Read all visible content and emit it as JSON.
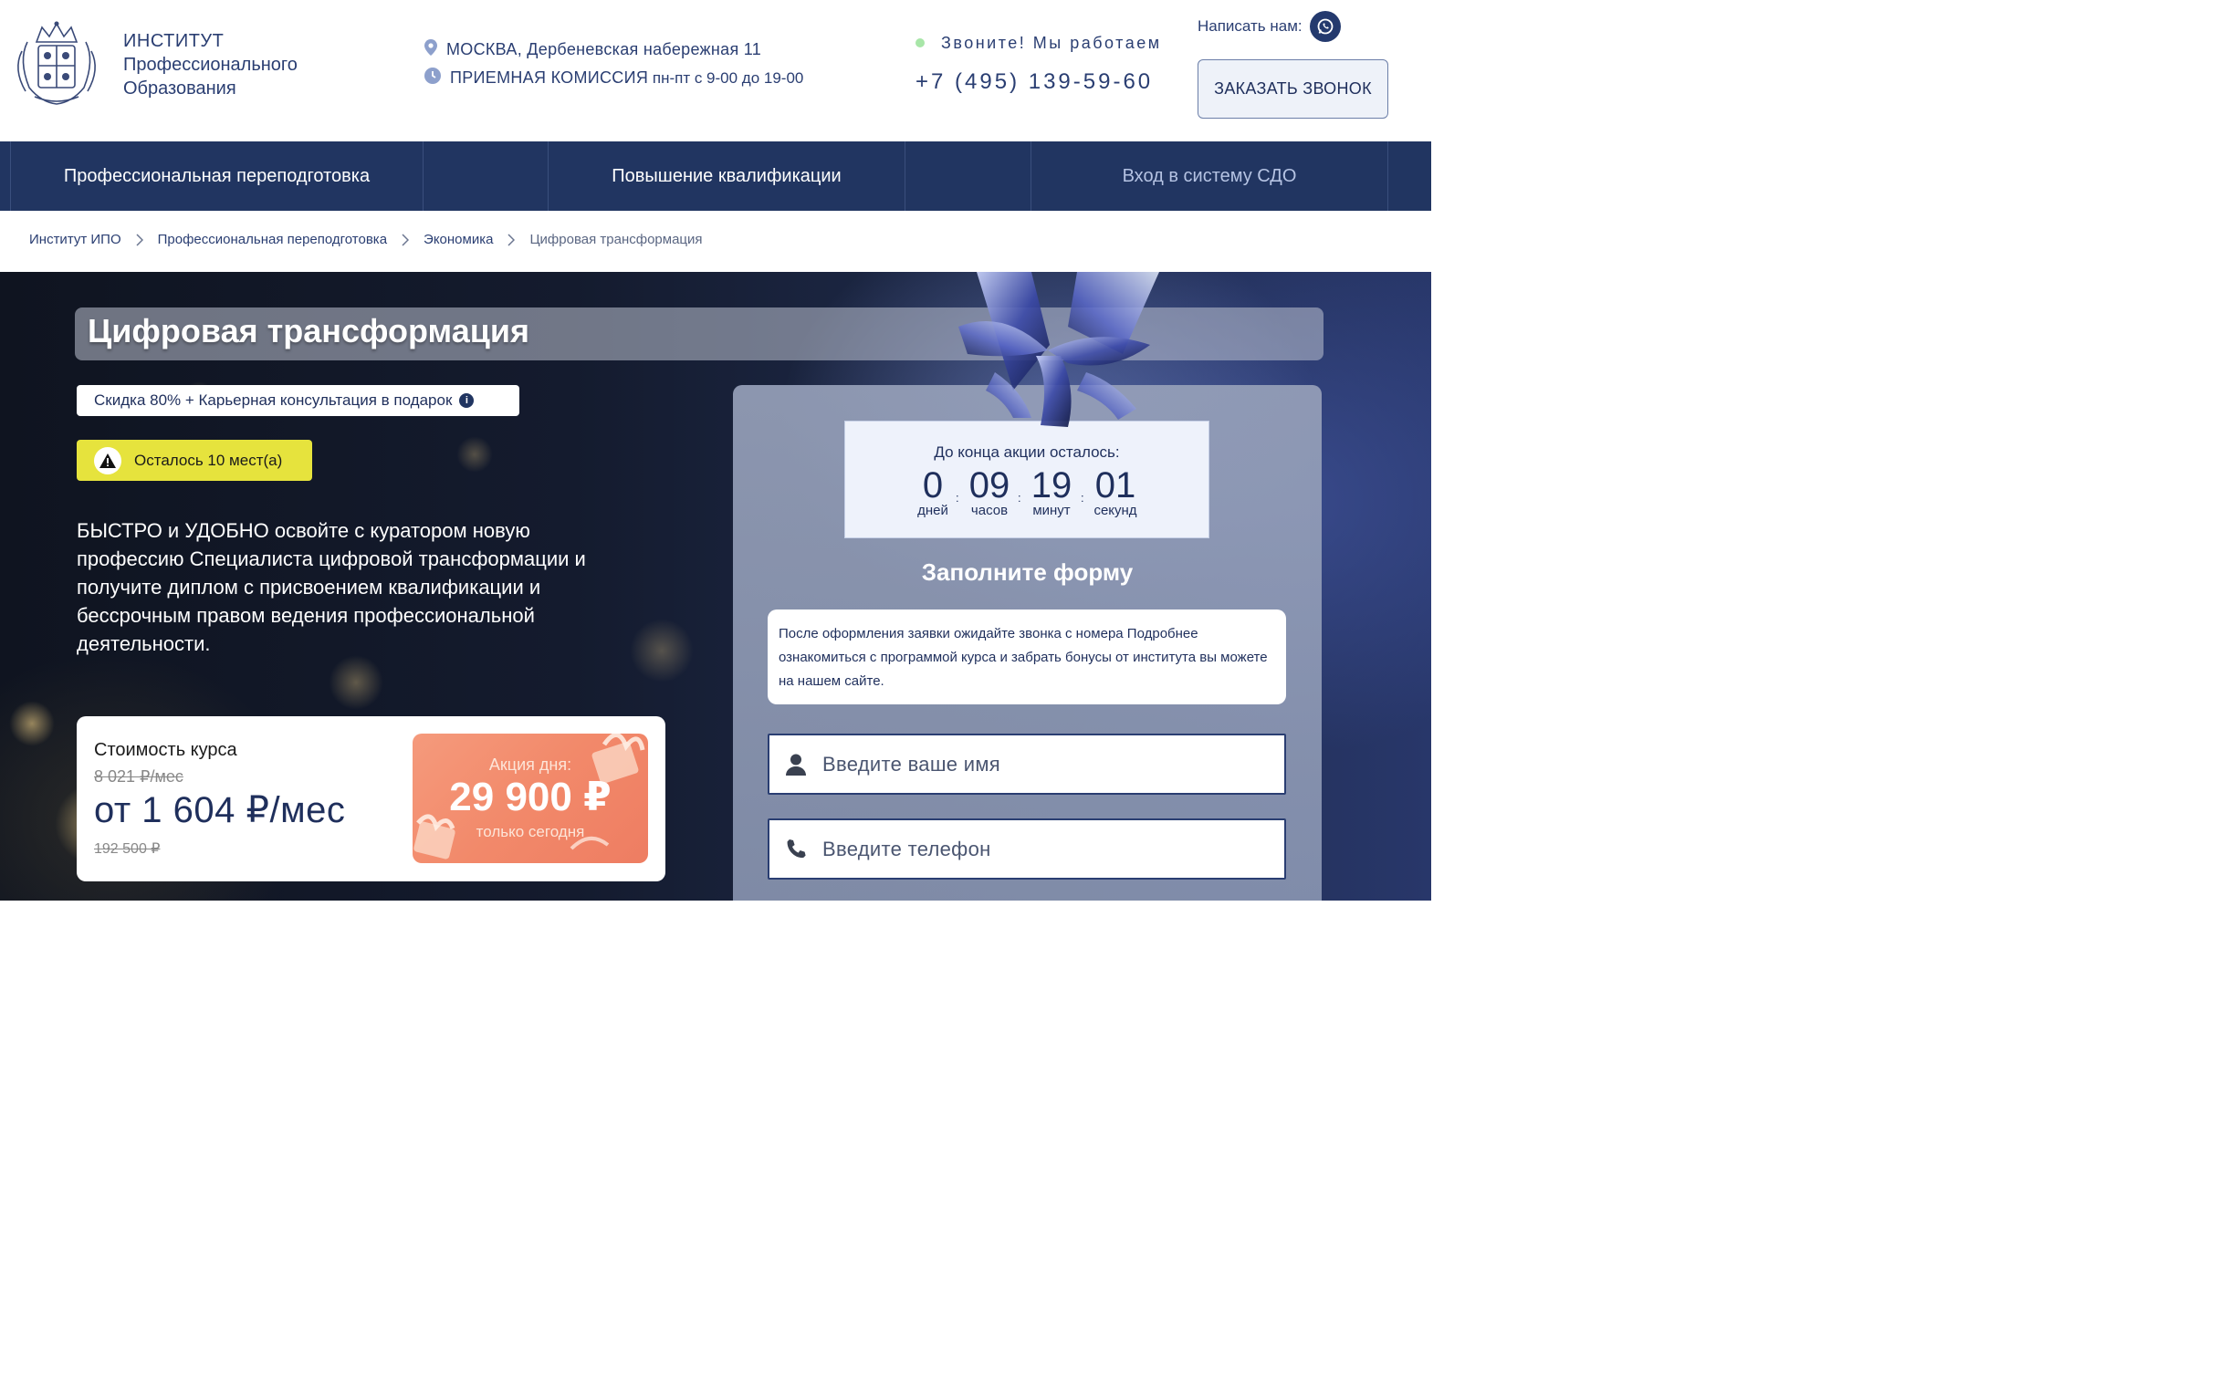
{
  "header": {
    "brand_line1": "ИНСТИТУТ",
    "brand_line2": "Профессионального",
    "brand_line3": "Образования",
    "address": "МОСКВА, Дербеневская набережная 11",
    "admission_label": "ПРИЕМНАЯ КОМИССИЯ",
    "admission_hours": " пн-пт с 9-00 до 19-00",
    "call_status": "Звоните! Мы работаем",
    "phone": "+7 (495) 139-59-60",
    "write_us": "Написать нам:",
    "order_call": "ЗАКАЗАТЬ ЗВОНОК"
  },
  "nav": {
    "item1": "Профессиональная переподготовка",
    "item2": "Повышение квалификации",
    "item3": "Вход в систему СДО"
  },
  "breadcrumb": [
    "Институт ИПО",
    "Профессиональная переподготовка",
    "Экономика",
    "Цифровая трансформация"
  ],
  "hero": {
    "title": "Цифровая трансформация",
    "promo": "Скидка 80% + Карьерная консультация в подарок",
    "seats": "Осталось 10 мест(а)",
    "description": "БЫСТРО и УДОБНО освойте с куратором новую профессию Специалиста цифровой трансформации и получите диплом с присвоением квалификации и бессрочным правом ведения профессиональной деятельности."
  },
  "price": {
    "label": "Стоимость курса",
    "old_monthly": "8 021 ₽/мес",
    "monthly": "от 1 604 ₽/мес",
    "old_total": "192 500 ₽",
    "deal_label": "Акция дня:",
    "deal_price": "29 900 ₽",
    "deal_note": "только сегодня"
  },
  "timer": {
    "label": "До конца акции осталось:",
    "days": "0",
    "days_unit": "дней",
    "hours": "09",
    "hours_unit": "часов",
    "minutes": "19",
    "minutes_unit": "минут",
    "seconds": "01",
    "seconds_unit": "секунд"
  },
  "form": {
    "title": "Заполните форму",
    "note": "После оформления заявки ожидайте звонка с номера Подробнее ознакомиться с программой курса и забрать бонусы от института вы можете на нашем сайте.",
    "name_placeholder": "Введите ваше имя",
    "phone_placeholder": "Введите телефон"
  },
  "icons": {
    "location": "map-pin-icon",
    "clock": "clock-icon",
    "whatsapp": "whatsapp-icon",
    "info": "info-icon",
    "warning": "warning-icon",
    "user": "user-icon",
    "phone": "phone-icon"
  },
  "colors": {
    "primary": "#213561",
    "accent_yellow": "#e6e33d",
    "deal_orange": "#f2896a",
    "status_green": "#a8e6a8"
  }
}
